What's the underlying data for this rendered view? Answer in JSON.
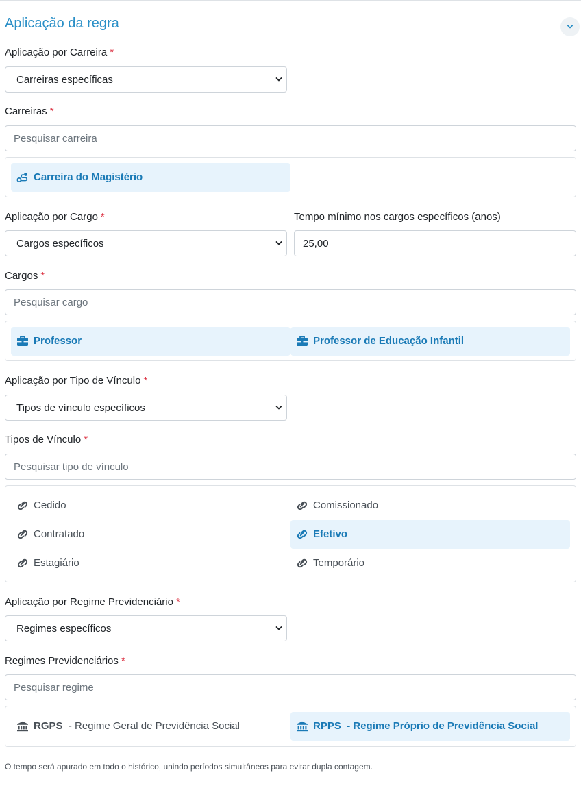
{
  "section": {
    "title": "Aplicação da regra",
    "collapse_icon": "chevron-down-icon"
  },
  "required_mark": "*",
  "carreira": {
    "label": "Aplicação por Carreira",
    "select_value": "Carreiras específicas",
    "list_label": "Carreiras",
    "search_placeholder": "Pesquisar carreira",
    "items": [
      {
        "label": "Carreira do Magistério",
        "icon": "route-icon",
        "selected": true
      }
    ]
  },
  "cargo": {
    "label": "Aplicação por Cargo",
    "select_value": "Cargos específicos",
    "tempo_label": "Tempo mínimo nos cargos específicos (anos)",
    "tempo_value": "25,00",
    "list_label": "Cargos",
    "search_placeholder": "Pesquisar cargo",
    "items": [
      {
        "label": "Professor",
        "icon": "briefcase-icon",
        "selected": true
      },
      {
        "label": "Professor de Educação Infantil",
        "icon": "briefcase-icon",
        "selected": true
      }
    ]
  },
  "vinculo": {
    "label": "Aplicação por Tipo de Vínculo",
    "select_value": "Tipos de vínculo específicos",
    "list_label": "Tipos de Vínculo",
    "search_placeholder": "Pesquisar tipo de vínculo",
    "items": [
      {
        "label": "Cedido",
        "icon": "link-icon",
        "selected": false
      },
      {
        "label": "Comissionado",
        "icon": "link-icon",
        "selected": false
      },
      {
        "label": "Contratado",
        "icon": "link-icon",
        "selected": false
      },
      {
        "label": "Efetivo",
        "icon": "link-icon",
        "selected": true
      },
      {
        "label": "Estagiário",
        "icon": "link-icon",
        "selected": false
      },
      {
        "label": "Temporário",
        "icon": "link-icon",
        "selected": false
      }
    ]
  },
  "regime": {
    "label": "Aplicação por Regime Previdenciário",
    "select_value": "Regimes específicos",
    "list_label": "Regimes Previdenciários",
    "search_placeholder": "Pesquisar regime",
    "items": [
      {
        "abbr": "RGPS",
        "name": "- Regime Geral de Previdência Social",
        "icon": "bank-icon",
        "selected": false
      },
      {
        "abbr": "RPPS",
        "name": "- Regime Próprio de Previdência Social",
        "icon": "bank-icon",
        "selected": true
      }
    ]
  },
  "footer_note": "O tempo será apurado em todo o histórico, unindo períodos simultâneos para evitar dupla contagem."
}
